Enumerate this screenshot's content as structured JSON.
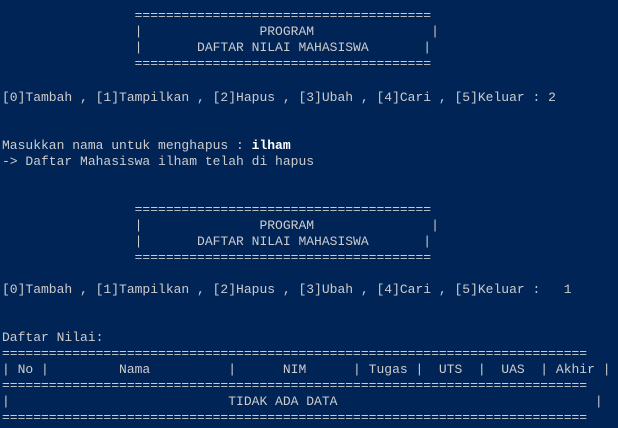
{
  "terminal": {
    "lines": [
      "                 ======================================",
      "                 |               PROGRAM               |",
      "                 |       DAFTAR NILAI MAHASISWA       |",
      "                 ======================================",
      "",
      "[0]Tambah , [1]Tampilkan , [2]Hapus , [3]Ubah , [4]Cari , [5]Keluar : 2",
      "",
      "",
      "Masukkan nama untuk menghapus : ",
      "-> Daftar Mahasiswa ilham telah di hapus",
      "",
      "",
      "                 ======================================",
      "                 |               PROGRAM               |",
      "                 |       DAFTAR NILAI MAHASISWA       |",
      "                 ======================================",
      "",
      "[0]Tambah , [1]Tampilkan , [2]Hapus , [3]Ubah , [4]Cari , [5]Keluar :   1",
      "",
      "",
      "Daftar Nilai:",
      "===========================================================================",
      "| No |         Nama          |      NIM      | Tugas |  UTS  |  UAS  | Akhir |",
      "===========================================================================",
      "|                            TIDAK ADA DATA                                 |",
      "==========================================================================="
    ],
    "input_name": "ilham"
  }
}
